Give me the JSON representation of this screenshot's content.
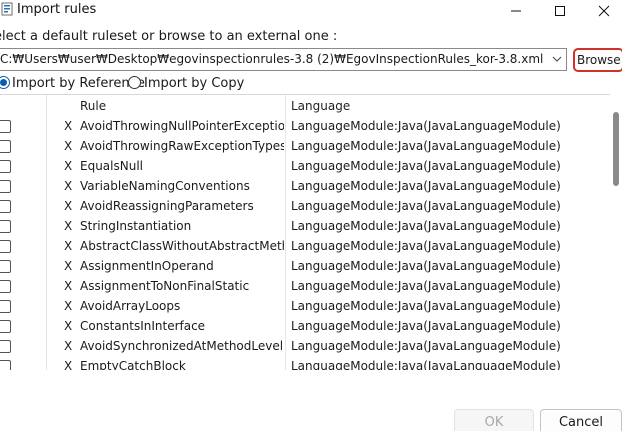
{
  "window": {
    "title": "Import rules",
    "icon": "eclipse-rule-icon",
    "controls": [
      "minimize-icon",
      "maximize-icon",
      "close-icon"
    ]
  },
  "prompt": "elect a default ruleset or browse to an external one :",
  "path_combo": {
    "value": "C:\\Users\\user\\Desktop\\egovinspectionrules-3.8 (2)\\EgovInspectionRules_kor-3.8.xml",
    "display": "C:₩Users₩user₩Desktop₩egovinspectionrules-3.8 (2)₩EgovInspectionRules_kor-3.8.xml"
  },
  "browse_button": {
    "label": "Browse...",
    "highlight_color": "#d0312d"
  },
  "import_mode": {
    "options": [
      "Import by Reference",
      "Import by Copy"
    ],
    "selected": "Import by Reference"
  },
  "table": {
    "columns": [
      "",
      "",
      "Rule",
      "Language"
    ],
    "rows": [
      {
        "checked": false,
        "x": "X",
        "rule": "AvoidThrowingNullPointerException",
        "language": "LanguageModule:Java(JavaLanguageModule)"
      },
      {
        "checked": false,
        "x": "X",
        "rule": "AvoidThrowingRawExceptionTypes",
        "language": "LanguageModule:Java(JavaLanguageModule)"
      },
      {
        "checked": false,
        "x": "X",
        "rule": "EqualsNull",
        "language": "LanguageModule:Java(JavaLanguageModule)"
      },
      {
        "checked": false,
        "x": "X",
        "rule": "VariableNamingConventions",
        "language": "LanguageModule:Java(JavaLanguageModule)"
      },
      {
        "checked": false,
        "x": "X",
        "rule": "AvoidReassigningParameters",
        "language": "LanguageModule:Java(JavaLanguageModule)"
      },
      {
        "checked": false,
        "x": "X",
        "rule": "StringInstantiation",
        "language": "LanguageModule:Java(JavaLanguageModule)"
      },
      {
        "checked": false,
        "x": "X",
        "rule": "AbstractClassWithoutAbstractMethod",
        "language": "LanguageModule:Java(JavaLanguageModule)"
      },
      {
        "checked": false,
        "x": "X",
        "rule": "AssignmentInOperand",
        "language": "LanguageModule:Java(JavaLanguageModule)"
      },
      {
        "checked": false,
        "x": "X",
        "rule": "AssignmentToNonFinalStatic",
        "language": "LanguageModule:Java(JavaLanguageModule)"
      },
      {
        "checked": false,
        "x": "X",
        "rule": "AvoidArrayLoops",
        "language": "LanguageModule:Java(JavaLanguageModule)"
      },
      {
        "checked": false,
        "x": "X",
        "rule": "ConstantsInInterface",
        "language": "LanguageModule:Java(JavaLanguageModule)"
      },
      {
        "checked": false,
        "x": "X",
        "rule": "AvoidSynchronizedAtMethodLevel",
        "language": "LanguageModule:Java(JavaLanguageModule)"
      },
      {
        "checked": false,
        "x": "X",
        "rule": "EmptyCatchBlock",
        "language": "LanguageModule:Java(JavaLanguageModule)"
      }
    ]
  },
  "footer": {
    "ok_label": "OK",
    "ok_enabled": false,
    "cancel_label": "Cancel"
  }
}
